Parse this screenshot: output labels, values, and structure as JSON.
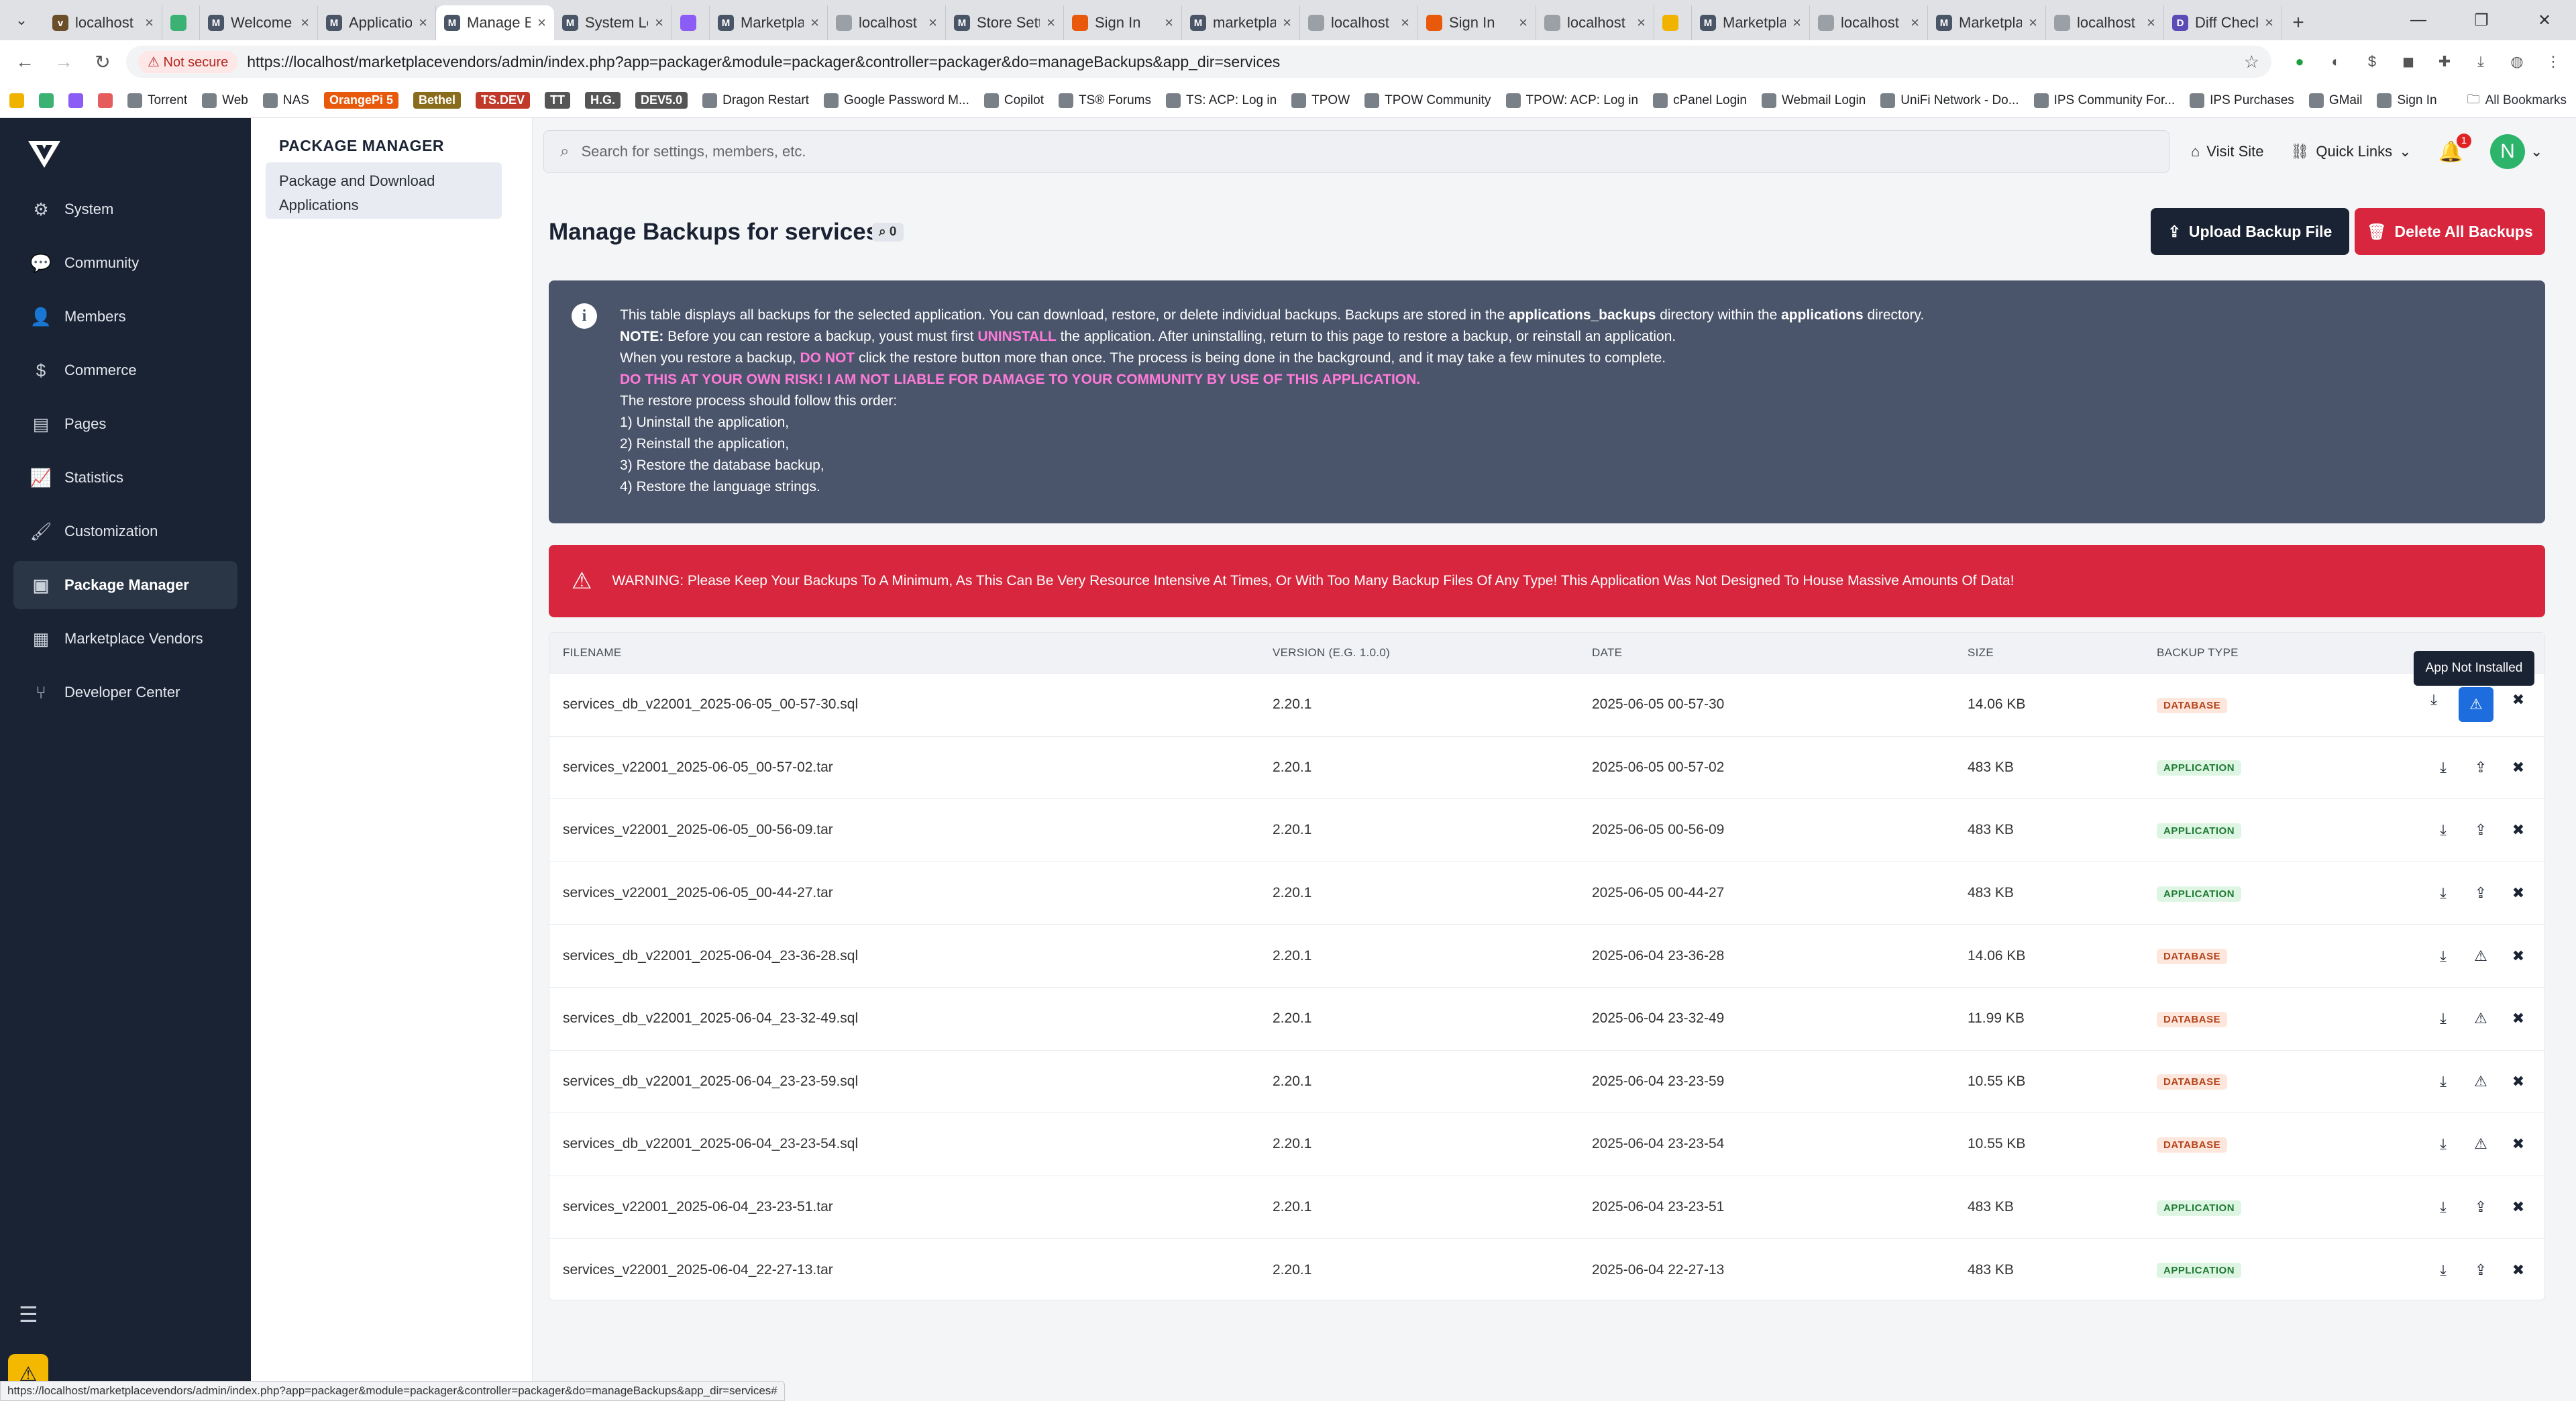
{
  "browser": {
    "tabs": [
      {
        "title": "localhost",
        "favicon": "v"
      },
      {
        "title": "",
        "favicon": "green-square"
      },
      {
        "title": "Welcome",
        "favicon": "M"
      },
      {
        "title": "Applications",
        "favicon": "M"
      },
      {
        "title": "Manage Backups",
        "favicon": "M",
        "active": true
      },
      {
        "title": "System Logs",
        "favicon": "M"
      },
      {
        "title": "",
        "favicon": "purple-square"
      },
      {
        "title": "Marketplace",
        "favicon": "M"
      },
      {
        "title": "localhost",
        "favicon": "globe"
      },
      {
        "title": "Store Settings",
        "favicon": "M"
      },
      {
        "title": "Sign In",
        "favicon": "orange-square"
      },
      {
        "title": "marketplace",
        "favicon": "M"
      },
      {
        "title": "localhost",
        "favicon": "globe"
      },
      {
        "title": "Sign In",
        "favicon": "orange-square"
      },
      {
        "title": "localhost",
        "favicon": "globe"
      },
      {
        "title": "",
        "favicon": "yellow-square"
      },
      {
        "title": "Marketplace",
        "favicon": "M"
      },
      {
        "title": "localhost",
        "favicon": "globe"
      },
      {
        "title": "Marketplace",
        "favicon": "M"
      },
      {
        "title": "localhost",
        "favicon": "globe"
      },
      {
        "title": "Diff Checker",
        "favicon": "D"
      }
    ],
    "not_secure": "Not secure",
    "url": "https://localhost/marketplacevendors/admin/index.php?app=packager&module=packager&controller=packager&do=manageBackups&app_dir=services",
    "bookmarks": [
      "Torrent",
      "Web",
      "NAS",
      "OrangePi 5",
      "Bethel",
      "TS.DEV",
      "TT",
      "H.G.",
      "DEV5.0",
      "Dragon Restart",
      "Google Password M...",
      "Copilot",
      "TS® Forums",
      "TS: ACP: Log in",
      "TPOW",
      "TPOW Community",
      "TPOW: ACP: Log in",
      "cPanel Login",
      "Webmail Login",
      "UniFi Network - Do...",
      "IPS Community For...",
      "IPS Purchases",
      "GMail",
      "Sign In"
    ],
    "all_bookmarks": "All Bookmarks",
    "status_url": "https://localhost/marketplacevendors/admin/index.php?app=packager&module=packager&controller=packager&do=manageBackups&app_dir=services#"
  },
  "sidebar": {
    "items": [
      {
        "label": "System",
        "icon": "gears-icon"
      },
      {
        "label": "Community",
        "icon": "comments-icon"
      },
      {
        "label": "Members",
        "icon": "user-icon"
      },
      {
        "label": "Commerce",
        "icon": "dollar-icon"
      },
      {
        "label": "Pages",
        "icon": "file-icon"
      },
      {
        "label": "Statistics",
        "icon": "chart-line-icon"
      },
      {
        "label": "Customization",
        "icon": "paintbrush-icon"
      },
      {
        "label": "Package Manager",
        "icon": "archive-box-icon"
      },
      {
        "label": "Marketplace Vendors",
        "icon": "storefront-icon"
      },
      {
        "label": "Developer Center",
        "icon": "code-branch-icon"
      }
    ]
  },
  "subnav": {
    "heading": "PACKAGE MANAGER",
    "item": "Package and Download Applications"
  },
  "header": {
    "search_placeholder": "Search for settings, members, etc.",
    "visit_site": "Visit Site",
    "quick_links": "Quick Links",
    "notification_count": "1",
    "avatar_letter": "N",
    "accent": "#2db46b"
  },
  "page": {
    "title": "Manage Backups for services",
    "count": "0",
    "upload_button": "Upload Backup File",
    "delete_button": "Delete All Backups",
    "info": {
      "l1a": "This table displays all backups for the selected application. You can download, restore, or delete individual backups. Backups are stored in the ",
      "l1b": "applications_backups",
      "l1c": " directory within the ",
      "l1d": "applications",
      "l1e": " directory.",
      "l2a": "NOTE:",
      "l2b": " Before you can restore a backup, youst must first ",
      "l2c": "UNINSTALL",
      "l2d": " the application. After uninstalling, return to this page to restore a backup, or reinstall an application.",
      "l3a": "When you restore a backup, ",
      "l3b": "DO NOT",
      "l3c": " click the restore button more than once. The process is being done in the background, and it may take a few minutes to complete.",
      "l4": "DO THIS AT YOUR OWN RISK! I AM NOT LIABLE FOR DAMAGE TO YOUR COMMUNITY BY USE OF THIS APPLICATION.",
      "l5": "The restore process should follow this order:",
      "l6": "1) Uninstall the application,",
      "l7": "2) Reinstall the application,",
      "l8": "3) Restore the database backup,",
      "l9": "4) Restore the language strings."
    },
    "warning": "WARNING: Please Keep Your Backups To A Minimum, As This Can Be Very Resource Intensive At Times, Or With Too Many Backup Files Of Any Type! This Application Was Not Designed To House Massive Amounts Of Data!",
    "tooltip": "App Not Installed"
  },
  "table": {
    "headers": [
      "FILENAME",
      "VERSION (E.G. 1.0.0)",
      "DATE",
      "SIZE",
      "BACKUP TYPE"
    ],
    "rows": [
      {
        "filename": "services_db_v22001_2025-06-05_00-57-30.sql",
        "version": "2.20.1",
        "date": "2025-06-05 00-57-30",
        "size": "14.06 KB",
        "type": "DATABASE"
      },
      {
        "filename": "services_v22001_2025-06-05_00-57-02.tar",
        "version": "2.20.1",
        "date": "2025-06-05 00-57-02",
        "size": "483 KB",
        "type": "APPLICATION"
      },
      {
        "filename": "services_v22001_2025-06-05_00-56-09.tar",
        "version": "2.20.1",
        "date": "2025-06-05 00-56-09",
        "size": "483 KB",
        "type": "APPLICATION"
      },
      {
        "filename": "services_v22001_2025-06-05_00-44-27.tar",
        "version": "2.20.1",
        "date": "2025-06-05 00-44-27",
        "size": "483 KB",
        "type": "APPLICATION"
      },
      {
        "filename": "services_db_v22001_2025-06-04_23-36-28.sql",
        "version": "2.20.1",
        "date": "2025-06-04 23-36-28",
        "size": "14.06 KB",
        "type": "DATABASE"
      },
      {
        "filename": "services_db_v22001_2025-06-04_23-32-49.sql",
        "version": "2.20.1",
        "date": "2025-06-04 23-32-49",
        "size": "11.99 KB",
        "type": "DATABASE"
      },
      {
        "filename": "services_db_v22001_2025-06-04_23-23-59.sql",
        "version": "2.20.1",
        "date": "2025-06-04 23-23-59",
        "size": "10.55 KB",
        "type": "DATABASE"
      },
      {
        "filename": "services_db_v22001_2025-06-04_23-23-54.sql",
        "version": "2.20.1",
        "date": "2025-06-04 23-23-54",
        "size": "10.55 KB",
        "type": "DATABASE"
      },
      {
        "filename": "services_v22001_2025-06-04_23-23-51.tar",
        "version": "2.20.1",
        "date": "2025-06-04 23-23-51",
        "size": "483 KB",
        "type": "APPLICATION"
      },
      {
        "filename": "services_v22001_2025-06-04_22-27-13.tar",
        "version": "2.20.1",
        "date": "2025-06-04 22-27-13",
        "size": "483 KB",
        "type": "APPLICATION"
      }
    ]
  }
}
